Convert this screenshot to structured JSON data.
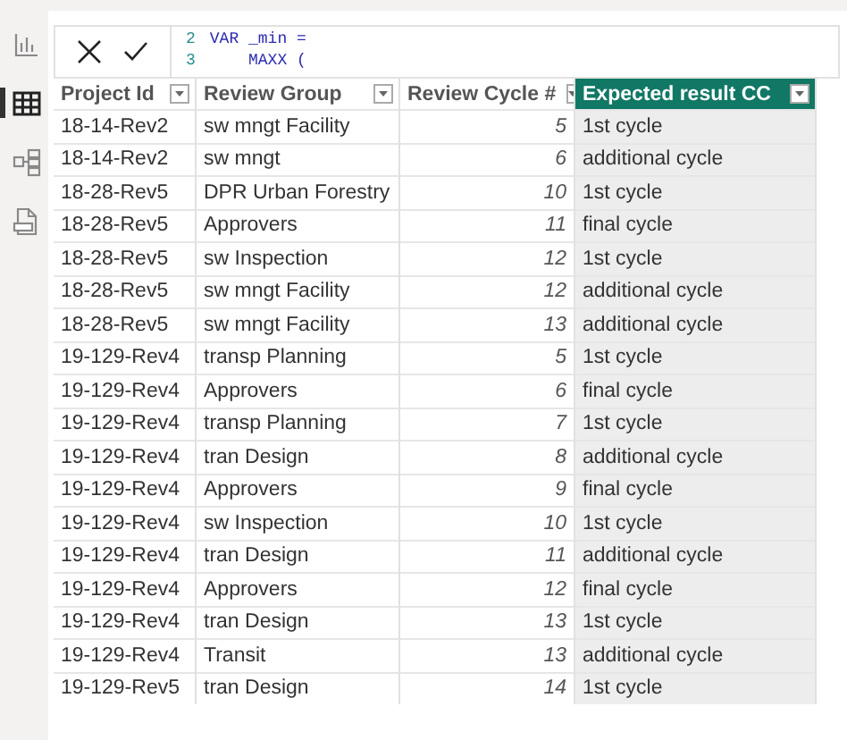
{
  "view_rail": [
    {
      "kind": "report",
      "selected": false
    },
    {
      "kind": "table",
      "selected": true
    },
    {
      "kind": "model",
      "selected": false
    },
    {
      "kind": "dax",
      "selected": false
    }
  ],
  "formula_bar": {
    "lines": [
      {
        "number": "2",
        "code": "VAR _min ="
      },
      {
        "number": "3",
        "code": "MAXX ("
      }
    ]
  },
  "table": {
    "columns": [
      {
        "name": "Project Id",
        "kind": "text",
        "selected": false
      },
      {
        "name": "Review Group",
        "kind": "text",
        "selected": false
      },
      {
        "name": "Review Cycle #",
        "kind": "number",
        "selected": false
      },
      {
        "name": "Expected result CC",
        "kind": "text",
        "selected": true
      }
    ],
    "rows": [
      [
        "18-14-Rev2",
        "sw mngt Facility",
        "5",
        "1st cycle"
      ],
      [
        "18-14-Rev2",
        "sw mngt",
        "6",
        "additional cycle"
      ],
      [
        "18-28-Rev5",
        "DPR Urban Forestry",
        "10",
        "1st cycle"
      ],
      [
        "18-28-Rev5",
        "Approvers",
        "11",
        "final cycle"
      ],
      [
        "18-28-Rev5",
        "sw Inspection",
        "12",
        "1st cycle"
      ],
      [
        "18-28-Rev5",
        "sw mngt Facility",
        "12",
        "additional cycle"
      ],
      [
        "18-28-Rev5",
        "sw mngt Facility",
        "13",
        "additional cycle"
      ],
      [
        "19-129-Rev4",
        "transp Planning",
        "5",
        "1st cycle"
      ],
      [
        "19-129-Rev4",
        "Approvers",
        "6",
        "final cycle"
      ],
      [
        "19-129-Rev4",
        "transp Planning",
        "7",
        "1st cycle"
      ],
      [
        "19-129-Rev4",
        "tran Design",
        "8",
        "additional cycle"
      ],
      [
        "19-129-Rev4",
        "Approvers",
        "9",
        "final cycle"
      ],
      [
        "19-129-Rev4",
        "sw Inspection",
        "10",
        "1st cycle"
      ],
      [
        "19-129-Rev4",
        "tran Design",
        "11",
        "additional cycle"
      ],
      [
        "19-129-Rev4",
        "Approvers",
        "12",
        "final cycle"
      ],
      [
        "19-129-Rev4",
        "tran Design",
        "13",
        "1st cycle"
      ],
      [
        "19-129-Rev4",
        "Transit",
        "13",
        "additional cycle"
      ],
      [
        "19-129-Rev5",
        "tran Design",
        "14",
        "1st cycle"
      ]
    ]
  }
}
